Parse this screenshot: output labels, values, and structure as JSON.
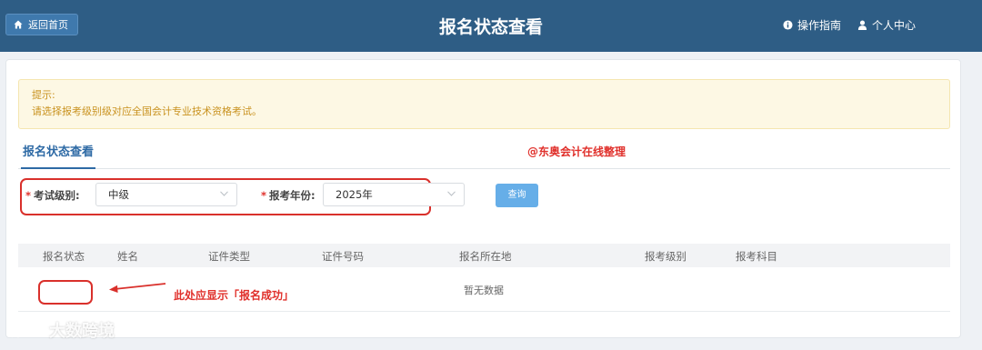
{
  "header": {
    "home_label": "返回首页",
    "title": "报名状态查看",
    "guide_label": "操作指南",
    "profile_label": "个人中心"
  },
  "notice": {
    "title": "提示:",
    "text": "请选择报考级别级对应全国会计专业技术资格考试。"
  },
  "tabs": [
    {
      "label": "报名状态查看",
      "active": true
    }
  ],
  "watermark_note": "@东奥会计在线整理",
  "filters": {
    "level_label": "考试级别:",
    "level_value": "中级",
    "year_label": "报考年份:",
    "year_value": "2025年",
    "query_label": "查询",
    "required_mark": "*"
  },
  "table": {
    "columns": [
      "报名状态",
      "姓名",
      "证件类型",
      "证件号码",
      "报名所在地",
      "报考级别",
      "报考科目"
    ],
    "empty_text": "暂无数据"
  },
  "annotation": {
    "note": "此处应显示「报名成功」"
  },
  "brand": {
    "name": "大数跨境"
  },
  "colors": {
    "header_bg": "#2e5d85",
    "accent": "#2e6aa5",
    "warning_text": "#c9921f",
    "annotation_red": "#d9302b",
    "query_button": "#66aee8"
  }
}
